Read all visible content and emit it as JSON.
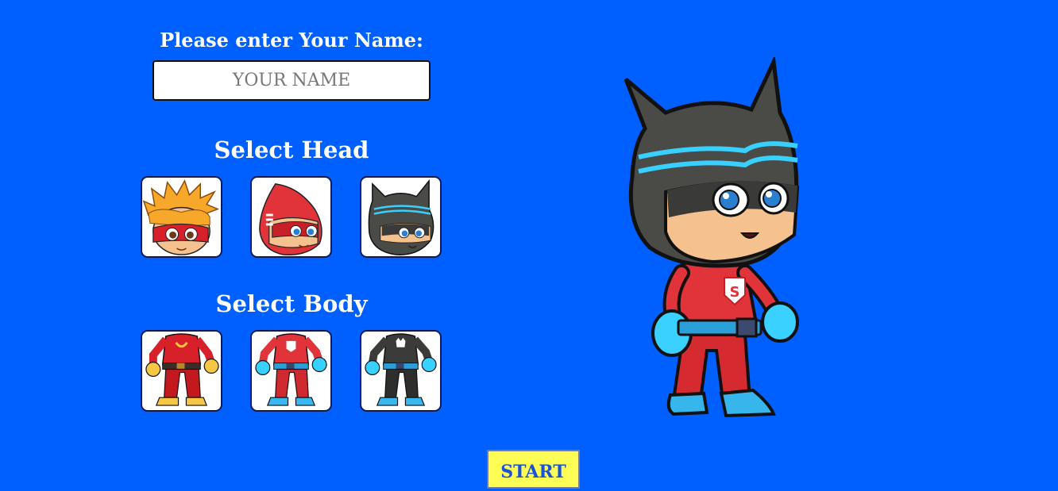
{
  "name_prompt": "Please enter Your Name:",
  "name_input": {
    "placeholder": "YOUR NAME",
    "value": ""
  },
  "heads": {
    "title": "Select Head",
    "options": [
      {
        "icon": "flame-hair-hero-head-icon"
      },
      {
        "icon": "red-drop-hood-hero-head-icon"
      },
      {
        "icon": "black-cat-mask-hero-head-icon"
      }
    ]
  },
  "bodies": {
    "title": "Select Body",
    "options": [
      {
        "icon": "red-yellow-suit-body-icon"
      },
      {
        "icon": "red-blue-suit-body-icon"
      },
      {
        "icon": "black-blue-suit-body-icon"
      }
    ]
  },
  "preview": {
    "icon": "character-preview-cat-hero",
    "chest_emblem": "S"
  },
  "start_button": {
    "label": "START"
  },
  "colors": {
    "background": "#005fff",
    "start_button_bg": "#fdfd56",
    "start_button_text": "#1a52d6",
    "suit_red": "#e0333a",
    "accent_cyan": "#38d0ff",
    "mask_gray": "#4a4a46",
    "skin": "#f4c18f"
  }
}
